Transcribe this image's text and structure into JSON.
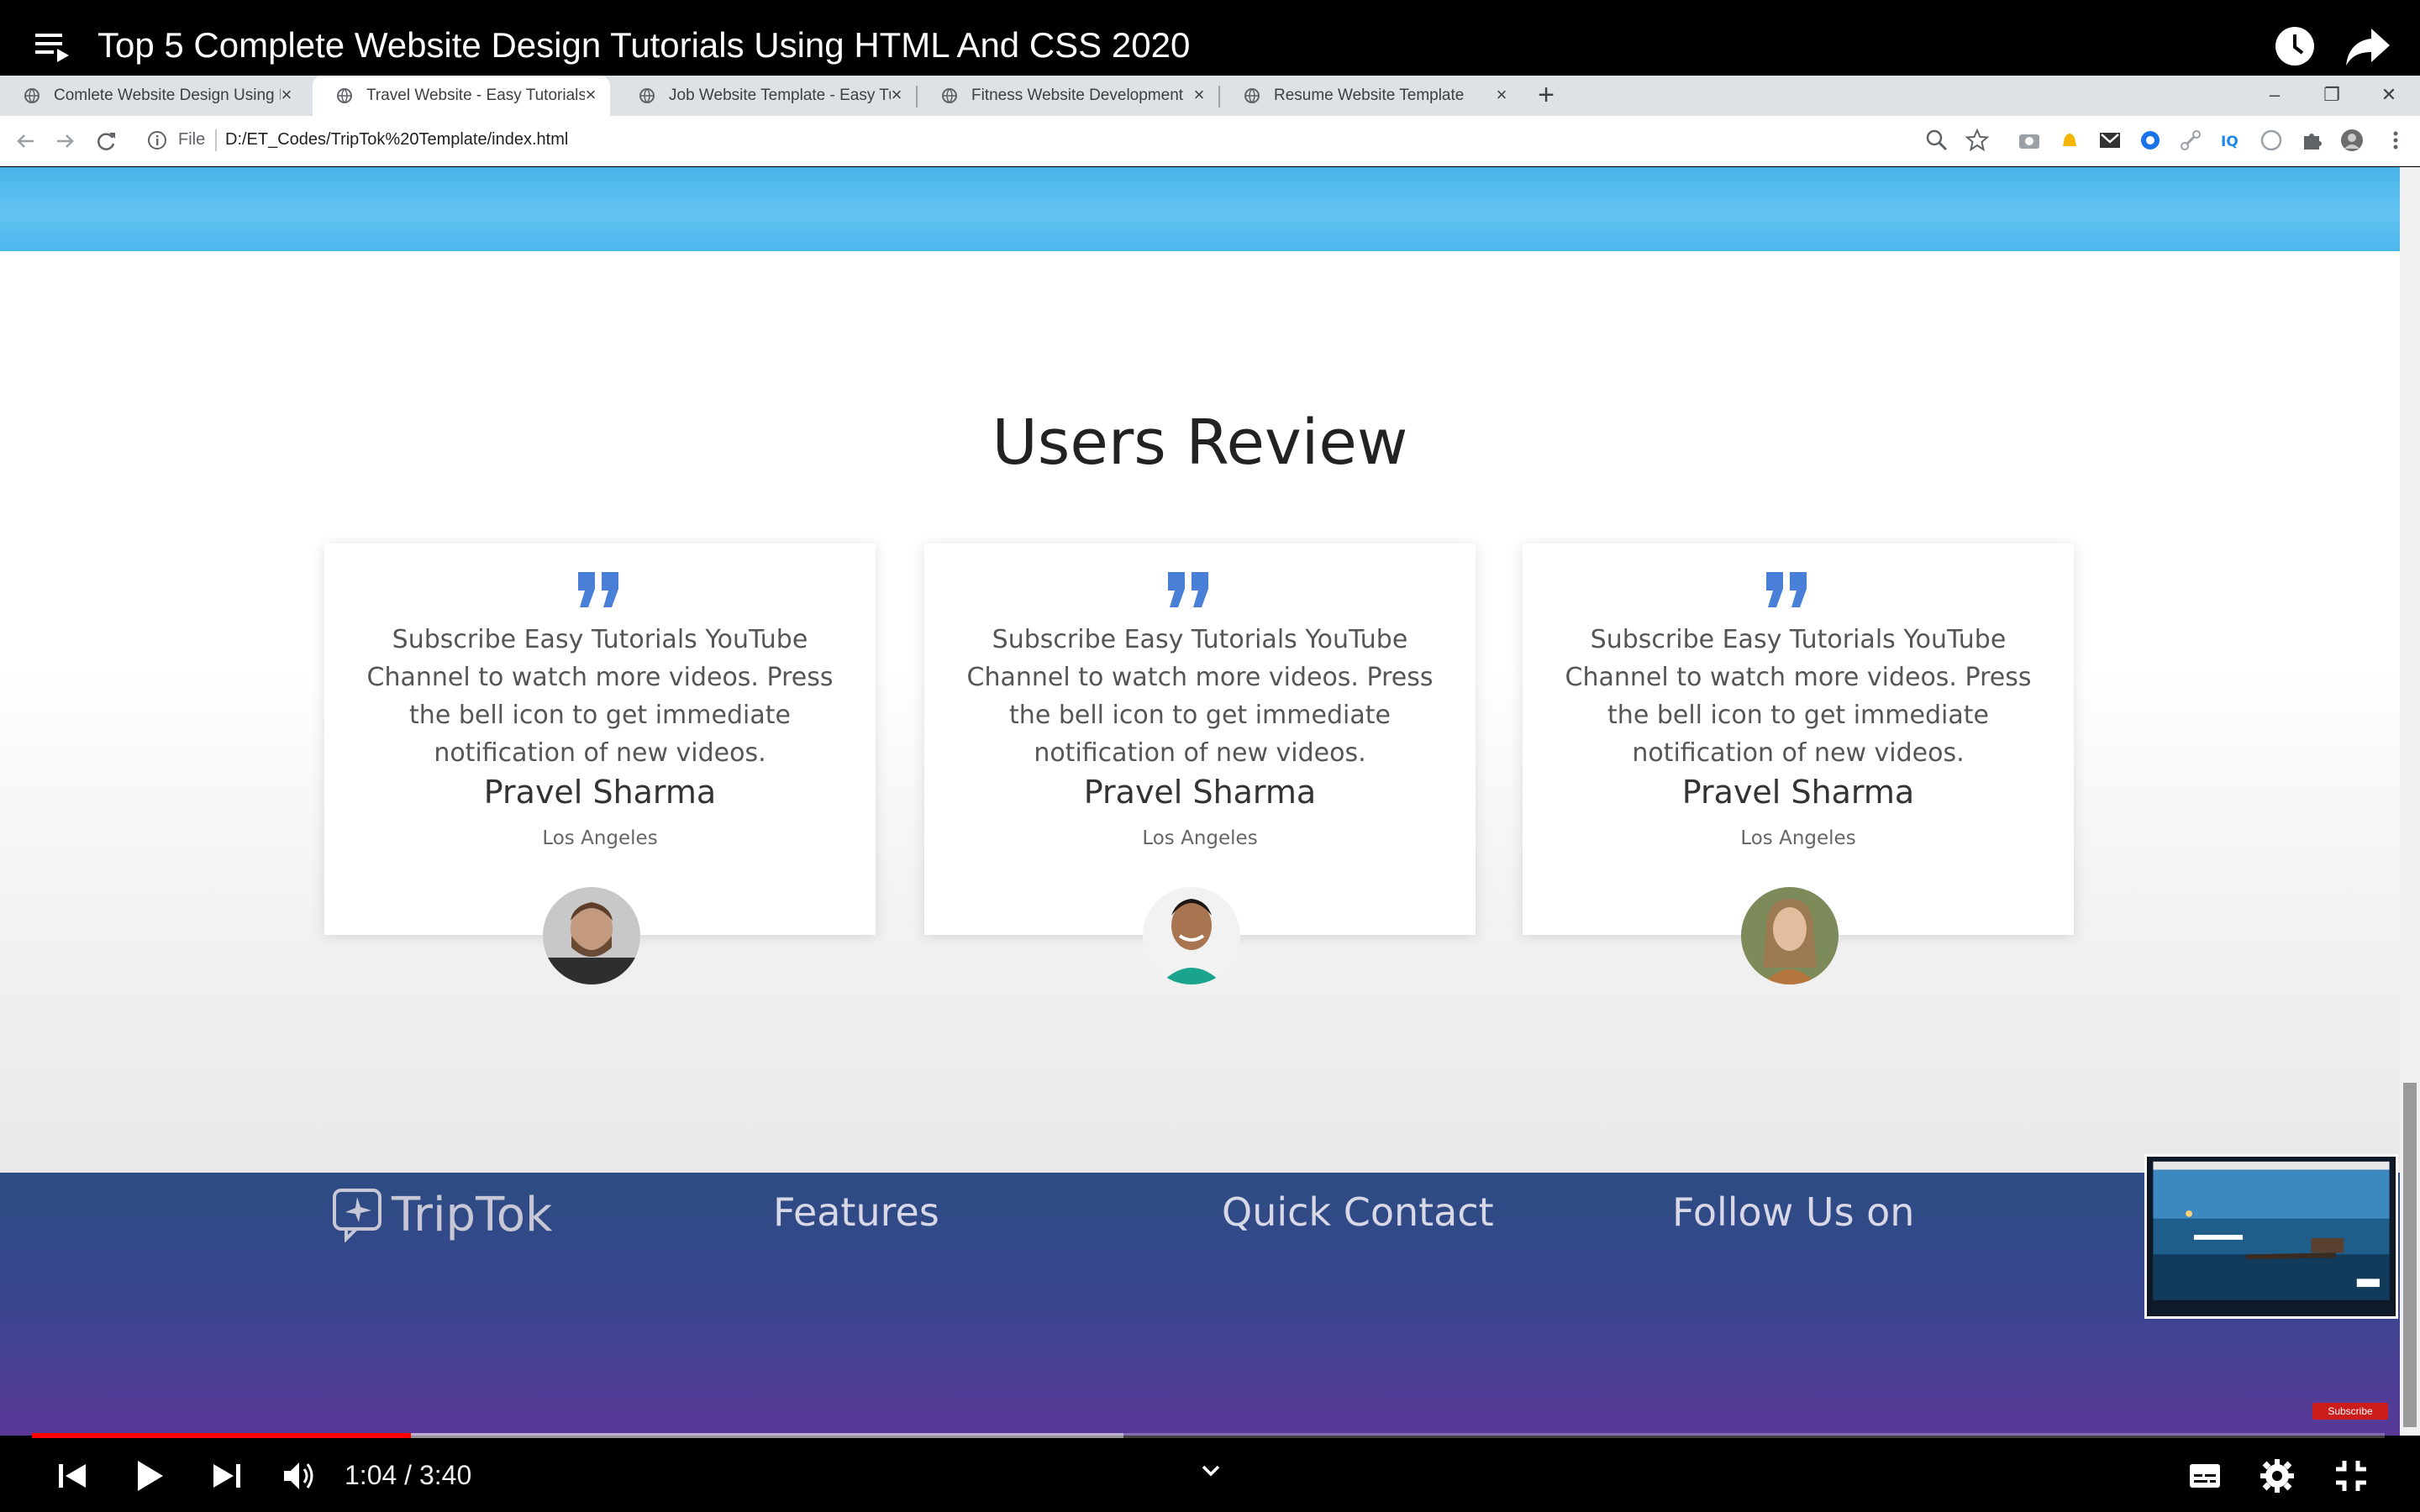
{
  "video": {
    "title": "Top 5 Complete Website Design Tutorials Using HTML And CSS 2020",
    "time_current": "1:04",
    "time_total": "3:40",
    "time_display": "1:04 / 3:40",
    "progress_played": 0.161,
    "progress_buffered": 0.464,
    "subscribe_badge": "Subscribe"
  },
  "browser": {
    "tabs": [
      {
        "label": "Comlete Website Design Using H",
        "active": false
      },
      {
        "label": "Travel Website - Easy Tutorials",
        "active": true
      },
      {
        "label": "Job Website Template - Easy Tut",
        "active": false
      },
      {
        "label": "Fitness Website Development",
        "active": false
      },
      {
        "label": "Resume Website Template",
        "active": false
      }
    ],
    "url_scheme": "File",
    "url": "D:/ET_Codes/TripTok%20Template/index.html"
  },
  "page": {
    "section_title": "Users Review",
    "reviews": [
      {
        "text": "Subscribe Easy Tutorials YouTube Channel to watch more videos. Press the bell icon to get immediate notification of new videos.",
        "name": "Pravel Sharma",
        "location": "Los Angeles"
      },
      {
        "text": "Subscribe Easy Tutorials YouTube Channel to watch more videos. Press the bell icon to get immediate notification of new videos.",
        "name": "Pravel Sharma",
        "location": "Los Angeles"
      },
      {
        "text": "Subscribe Easy Tutorials YouTube Channel to watch more videos. Press the bell icon to get immediate notification of new videos.",
        "name": "Pravel Sharma",
        "location": "Los Angeles"
      }
    ],
    "footer": {
      "logo_text": "TripTok",
      "headings": [
        "Features",
        "Quick Contact",
        "Follow Us on"
      ]
    }
  },
  "colors": {
    "accent_quote": "#4a7fd8",
    "footer_top": "#2c4c82",
    "footer_bottom": "#5a3898",
    "progress": "#ff0000"
  }
}
